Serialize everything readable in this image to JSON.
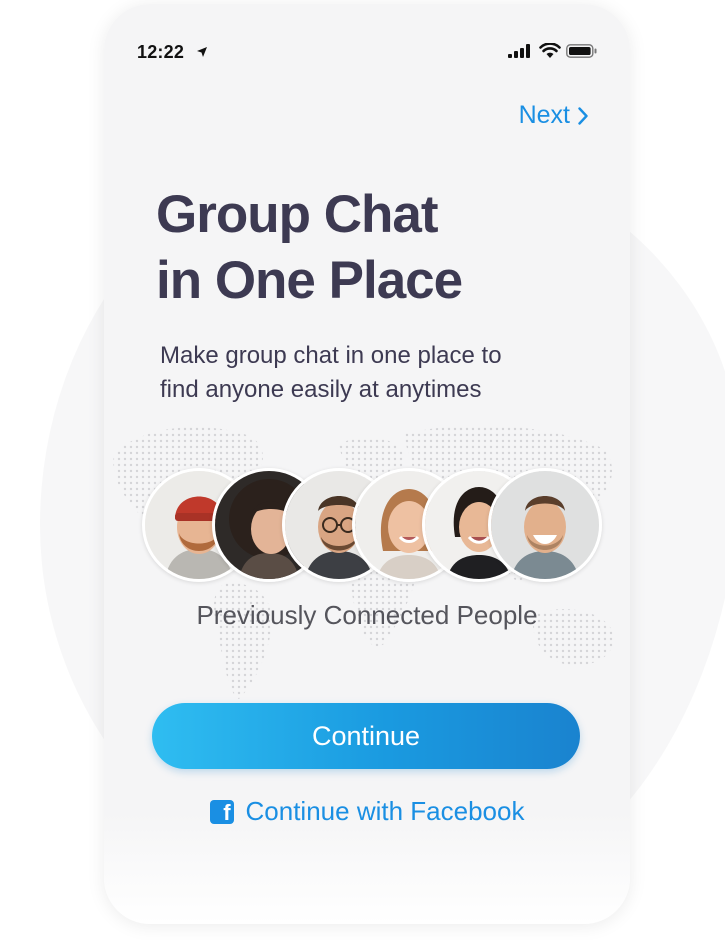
{
  "status_bar": {
    "time": "12:22"
  },
  "nav": {
    "next_label": "Next"
  },
  "main": {
    "title_line1": "Group Chat",
    "title_line2": "in One Place",
    "subtitle_line1": "Make group chat in one place to",
    "subtitle_line2": "find anyone easily at anytimes",
    "people_caption": "Previously Connected People"
  },
  "actions": {
    "continue_label": "Continue",
    "facebook_label": "Continue with Facebook"
  },
  "colors": {
    "accent": "#1a8fe3",
    "title": "#3d3a52",
    "button_start": "#2fbdf1",
    "button_end": "#1a83cf"
  },
  "avatars": [
    {
      "icon": "person-red-beanie-avatar"
    },
    {
      "icon": "person-curly-hair-avatar"
    },
    {
      "icon": "person-glasses-avatar"
    },
    {
      "icon": "person-smiling-woman-avatar"
    },
    {
      "icon": "person-dark-hair-woman-avatar"
    },
    {
      "icon": "person-laughing-man-avatar"
    }
  ]
}
